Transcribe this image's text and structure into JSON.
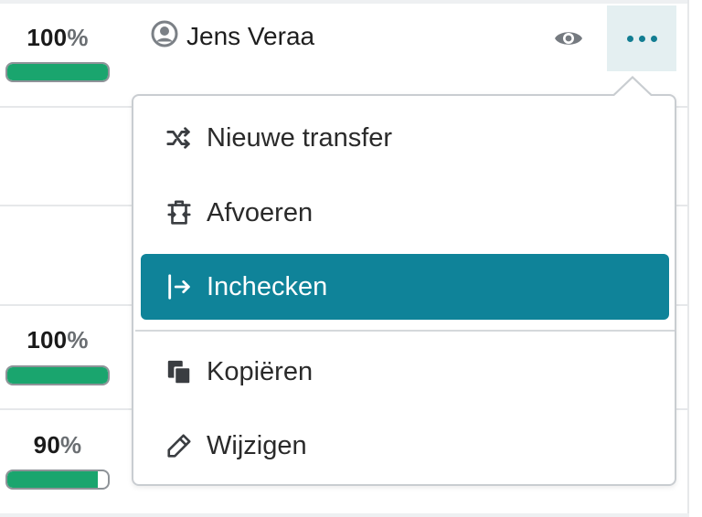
{
  "rows": [
    {
      "percent_num": "100",
      "percent_sign": "%",
      "progress": 1.0
    },
    {
      "percent_num": "100",
      "percent_sign": "%",
      "progress": 1.0
    },
    {
      "percent_num": "90",
      "percent_sign": "%",
      "progress": 0.9
    }
  ],
  "user": {
    "name": "Jens Veraa"
  },
  "menu": {
    "items": [
      {
        "label": "Nieuwe transfer",
        "icon": "shuffle-icon"
      },
      {
        "label": "Afvoeren",
        "icon": "dispose-icon"
      },
      {
        "label": "Inchecken",
        "icon": "check-in-icon",
        "active": true
      },
      {
        "label": "Kopiëren",
        "icon": "copy-icon"
      },
      {
        "label": "Wijzigen",
        "icon": "pencil-icon"
      }
    ]
  },
  "colors": {
    "accent": "#0f8399",
    "progress": "#1aa56e",
    "more_button_bg": "#e4eff1"
  }
}
